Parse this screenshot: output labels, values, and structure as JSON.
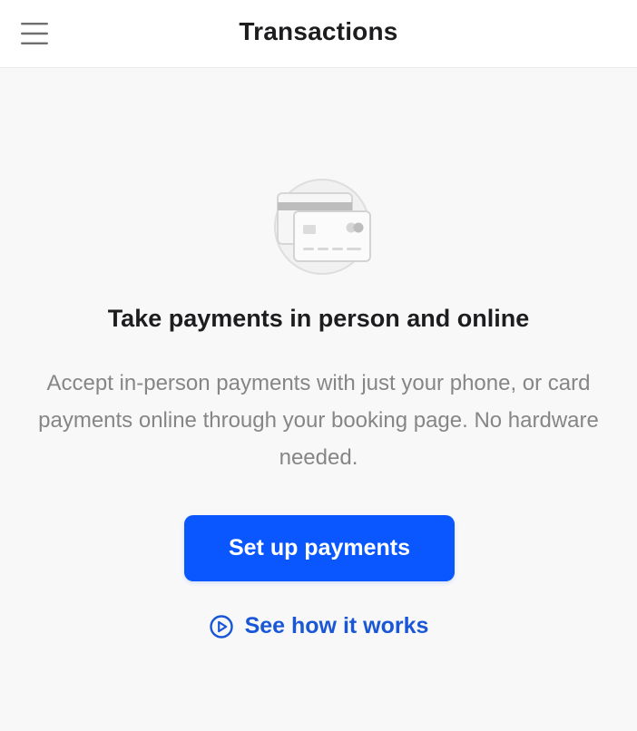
{
  "header": {
    "title": "Transactions",
    "menu_icon": "hamburger-menu-icon"
  },
  "empty_state": {
    "illustration_icon": "credit-card-icon",
    "headline": "Take payments in person and online",
    "description": "Accept in-person payments with just your phone, or card payments online through your booking page. No hardware needed.",
    "primary_button_label": "Set up payments",
    "secondary_link_label": "See how it works",
    "secondary_link_icon": "play-circle-icon"
  },
  "colors": {
    "accent": "#0a57ff",
    "link": "#1a57d6",
    "background": "#f8f8f8",
    "header_background": "#ffffff"
  }
}
